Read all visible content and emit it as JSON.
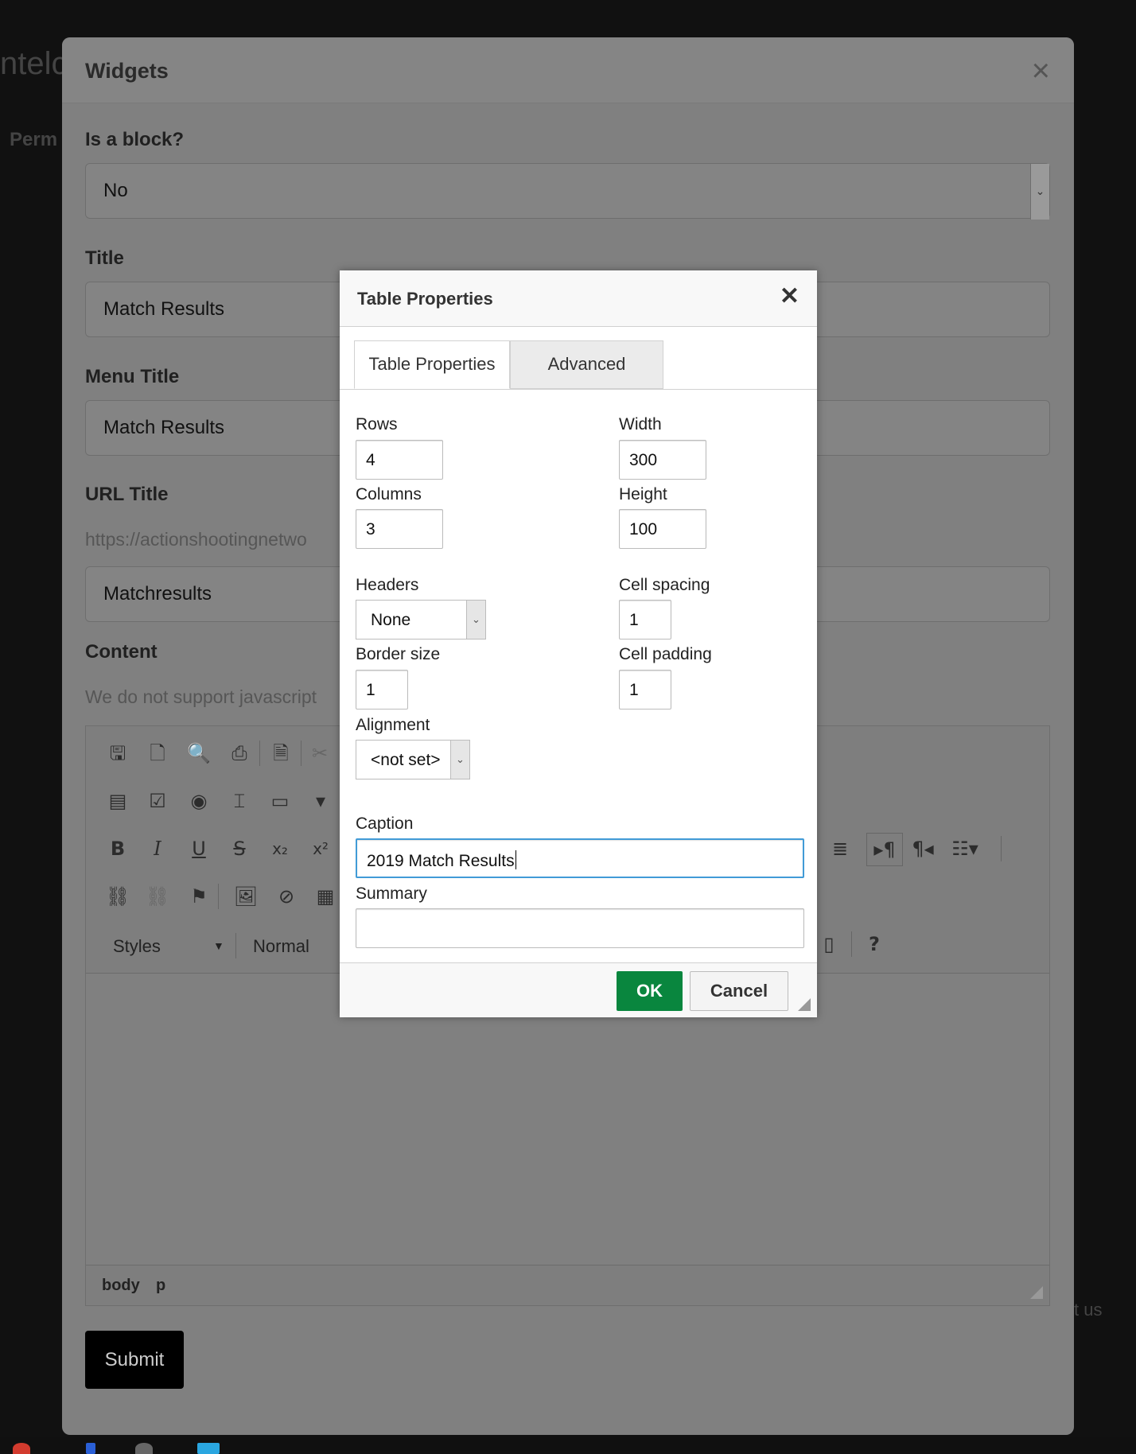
{
  "background": {
    "left_text_top": "ntelc",
    "left_text_perm": "Perm",
    "right_text": "t us"
  },
  "widgets": {
    "title": "Widgets",
    "close_icon": "×",
    "is_block": {
      "label": "Is a block?",
      "value": "No"
    },
    "title_field": {
      "label": "Title",
      "value": "Match Results"
    },
    "menu_title": {
      "label": "Menu Title",
      "value": "Match Results"
    },
    "url_title": {
      "label": "URL Title",
      "url_prefix": "https://actionshootingnetwo",
      "value": "Matchresults"
    },
    "content": {
      "label": "Content",
      "note": "We do not support javascript"
    },
    "editor": {
      "styles_label": "Styles",
      "format_label": "Normal",
      "help_label": "?",
      "status_path": [
        "body",
        "p"
      ]
    },
    "submit_label": "Submit"
  },
  "dialog": {
    "title": "Table Properties",
    "close_icon": "✕",
    "tabs": [
      {
        "label": "Table Properties",
        "active": true
      },
      {
        "label": "Advanced",
        "active": false
      }
    ],
    "rows": {
      "label": "Rows",
      "value": "4"
    },
    "columns": {
      "label": "Columns",
      "value": "3"
    },
    "width": {
      "label": "Width",
      "value": "300"
    },
    "height": {
      "label": "Height",
      "value": "100"
    },
    "headers": {
      "label": "Headers",
      "value": "None"
    },
    "cell_spacing": {
      "label": "Cell spacing",
      "value": "1"
    },
    "border_size": {
      "label": "Border size",
      "value": "1"
    },
    "cell_padding": {
      "label": "Cell padding",
      "value": "1"
    },
    "alignment": {
      "label": "Alignment",
      "value": "<not set>"
    },
    "caption": {
      "label": "Caption",
      "value": "2019 Match Results"
    },
    "summary": {
      "label": "Summary",
      "value": ""
    },
    "ok_label": "OK",
    "cancel_label": "Cancel"
  },
  "colors": {
    "ok_button": "#09863e",
    "focus_border": "#419bd7",
    "overlay": "#808080"
  }
}
